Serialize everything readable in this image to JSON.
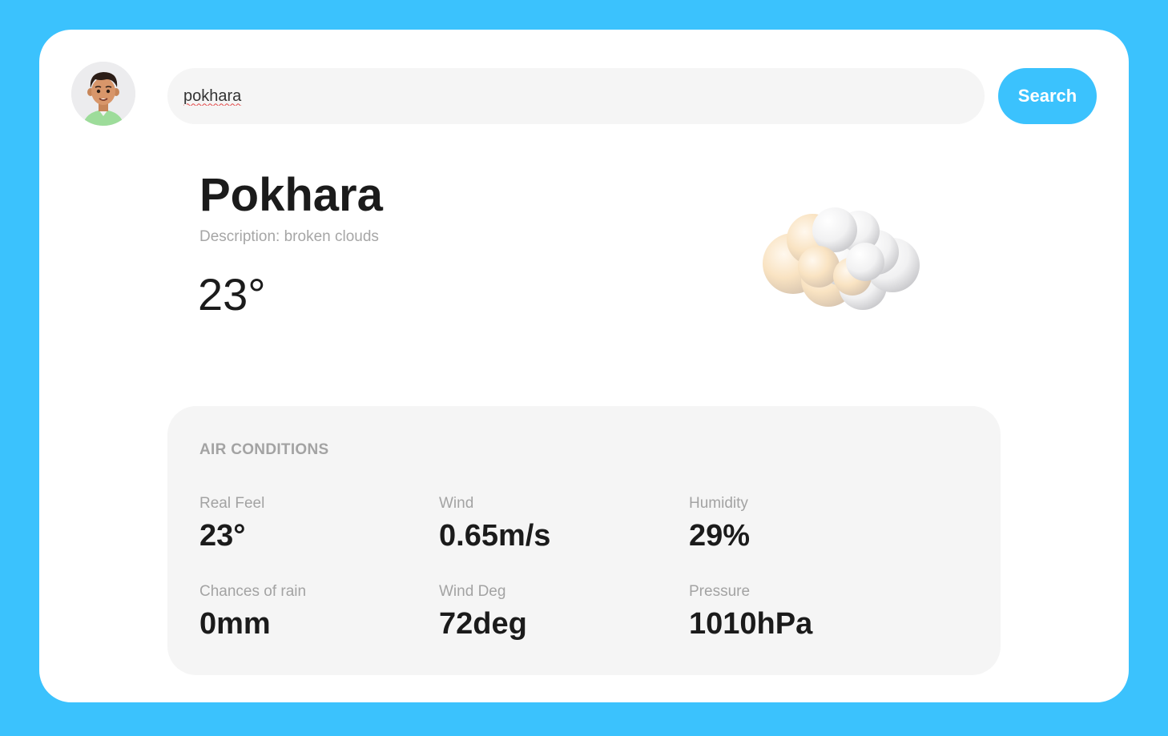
{
  "search": {
    "value": "pokhara",
    "button_label": "Search"
  },
  "weather": {
    "city": "Pokhara",
    "description_label": "Description: ",
    "description": "broken clouds",
    "temperature": "23°",
    "icon": "cloud-icon"
  },
  "air_conditions": {
    "title": "AIR CONDITIONS",
    "metrics": [
      {
        "label": "Real Feel",
        "value": "23°"
      },
      {
        "label": "Wind",
        "value": "0.65m/s"
      },
      {
        "label": "Humidity",
        "value": "29%"
      },
      {
        "label": "Chances of rain",
        "value": "0mm"
      },
      {
        "label": "Wind Deg",
        "value": "72deg"
      },
      {
        "label": "Pressure",
        "value": "1010hPa"
      }
    ]
  },
  "colors": {
    "accent": "#3bc2fd",
    "card": "#ffffff",
    "panel": "#f5f5f5",
    "text_primary": "#1b1b1b",
    "text_muted": "#a3a3a3"
  }
}
